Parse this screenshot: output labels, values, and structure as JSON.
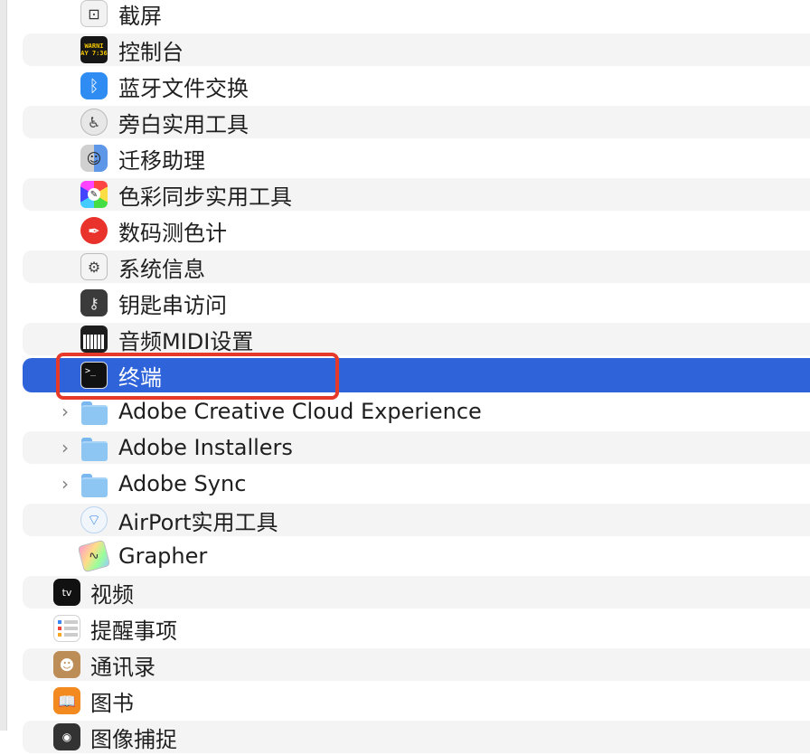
{
  "rows": [
    {
      "label": "截屏",
      "icon": "screenshot-icon",
      "level": 2,
      "stripe": false
    },
    {
      "label": "控制台",
      "icon": "console-icon",
      "icon_text": "WARNI\nAY 7:36",
      "level": 2,
      "stripe": true
    },
    {
      "label": "蓝牙文件交换",
      "icon": "bluetooth-icon",
      "level": 2,
      "stripe": false
    },
    {
      "label": "旁白实用工具",
      "icon": "voiceover-utility-icon",
      "level": 2,
      "stripe": true
    },
    {
      "label": "迁移助理",
      "icon": "migration-assistant-icon",
      "level": 2,
      "stripe": false
    },
    {
      "label": "色彩同步实用工具",
      "icon": "colorsync-icon",
      "level": 2,
      "stripe": true
    },
    {
      "label": "数码测色计",
      "icon": "digital-color-meter-icon",
      "level": 2,
      "stripe": false
    },
    {
      "label": "系统信息",
      "icon": "system-information-icon",
      "level": 2,
      "stripe": true
    },
    {
      "label": "钥匙串访问",
      "icon": "keychain-icon",
      "level": 2,
      "stripe": false
    },
    {
      "label": "音频MIDI设置",
      "icon": "audio-midi-icon",
      "level": 2,
      "stripe": true
    },
    {
      "label": "终端",
      "icon": "terminal-icon",
      "level": 2,
      "stripe": false,
      "selected": true
    },
    {
      "label": "Adobe Creative Cloud Experience",
      "icon": "folder-icon",
      "level": 2,
      "stripe": false,
      "disclosure": true
    },
    {
      "label": "Adobe Installers",
      "icon": "folder-icon",
      "level": 2,
      "stripe": true,
      "disclosure": true
    },
    {
      "label": "Adobe Sync",
      "icon": "folder-icon",
      "level": 2,
      "stripe": false,
      "disclosure": true
    },
    {
      "label": "AirPort实用工具",
      "icon": "airport-utility-icon",
      "level": 2,
      "stripe": true
    },
    {
      "label": "Grapher",
      "icon": "grapher-icon",
      "level": 2,
      "stripe": false
    },
    {
      "label": "视频",
      "icon": "apple-tv-icon",
      "icon_text": "tv",
      "level": 1,
      "stripe": true
    },
    {
      "label": "提醒事项",
      "icon": "reminders-icon",
      "level": 1,
      "stripe": false
    },
    {
      "label": "通讯录",
      "icon": "contacts-icon",
      "level": 1,
      "stripe": true
    },
    {
      "label": "图书",
      "icon": "books-icon",
      "level": 1,
      "stripe": false
    },
    {
      "label": "图像捕捉",
      "icon": "image-capture-icon",
      "level": 1,
      "stripe": true
    }
  ],
  "colors": {
    "selection": "#2f63d9",
    "annotation": "#e5392a",
    "stripe": "#f4f4f4"
  }
}
